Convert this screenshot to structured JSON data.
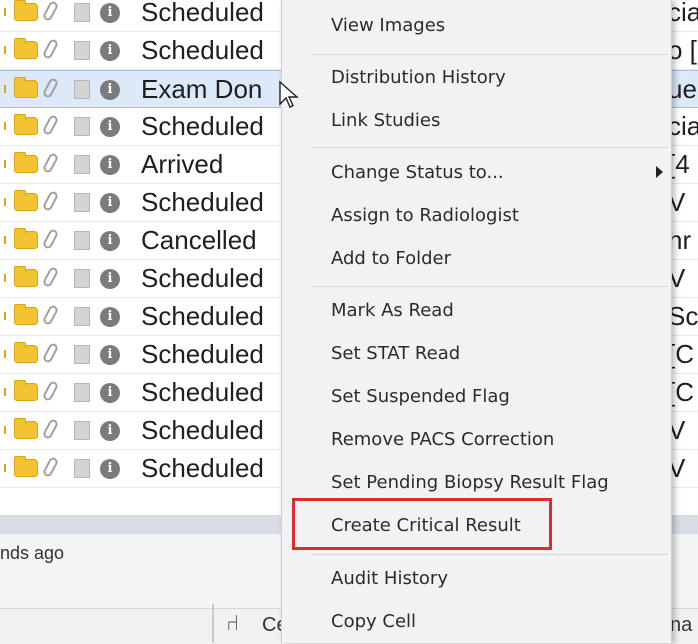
{
  "worklist": {
    "rows": [
      {
        "status": "Scheduled",
        "right": "cia"
      },
      {
        "status": "Scheduled",
        "right": "o ["
      },
      {
        "status": "Exam Don",
        "right": "ue",
        "selected": true
      },
      {
        "status": "Scheduled",
        "right": "cia"
      },
      {
        "status": "Arrived",
        "right": "[4"
      },
      {
        "status": "Scheduled",
        "right": "V"
      },
      {
        "status": "Cancelled",
        "right": "hr"
      },
      {
        "status": "Scheduled",
        "right": "V"
      },
      {
        "status": "Scheduled",
        "right": "Sc"
      },
      {
        "status": "Scheduled",
        "right": "[C"
      },
      {
        "status": "Scheduled",
        "right": "[C"
      },
      {
        "status": "Scheduled",
        "right": "V"
      },
      {
        "status": "Scheduled",
        "right": "V"
      }
    ],
    "icons": [
      "folder-icon",
      "paperclip-icon",
      "note-icon",
      "info-icon"
    ]
  },
  "status_bar": {
    "text": "nds ago"
  },
  "taskbar": {
    "item1": "Ce",
    "item2": "na"
  },
  "context_menu": {
    "items": [
      "View Images",
      "Distribution History",
      "Link Studies",
      "Change Status to...",
      "Assign to Radiologist",
      "Add to Folder",
      "Mark As Read",
      "Set STAT Read",
      "Set Suspended Flag",
      "Remove PACS Correction",
      "Set Pending Biopsy Result Flag",
      "Create Critical Result",
      "Audit History",
      "Copy Cell"
    ],
    "highlighted_item": "Create Critical Result",
    "highlight_color": "#d92f2f"
  }
}
